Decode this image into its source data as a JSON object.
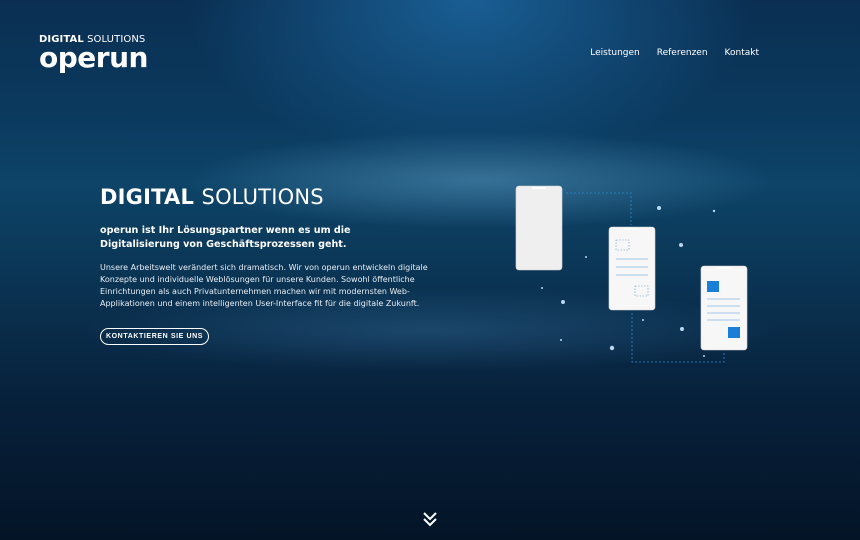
{
  "logo": {
    "top_bold": "DIGITAL",
    "top_light": "SOLUTIONS",
    "word": "operun"
  },
  "nav": {
    "items": [
      "Leistungen",
      "Referenzen",
      "Kontakt"
    ]
  },
  "hero": {
    "title_bold": "DIGITAL",
    "title_light": "SOLUTIONS",
    "lead": "operun ist Ihr Lösungspartner wenn es um die Digitalisierung von Geschäftsprozessen geht.",
    "body": "Unsere Arbeitswelt verändert sich dramatisch. Wir von operun entwickeln digitale Konzepte und individuelle Weblösungen für unsere Kunden. Sowohl öffentliche Einrichtungen als auch Privatunternehmen machen wir mit modernsten Web-Applikationen und einem intelligenten User-Interface fit für die digitale Zukunft.",
    "cta_label": "KONTAKTIEREN SIE UNS"
  },
  "icons": {
    "illustration": "phones-illustration",
    "scroll": "double-chevron-down-icon"
  },
  "colors": {
    "accent": "#1a7fd6",
    "background": "#0a3150"
  }
}
